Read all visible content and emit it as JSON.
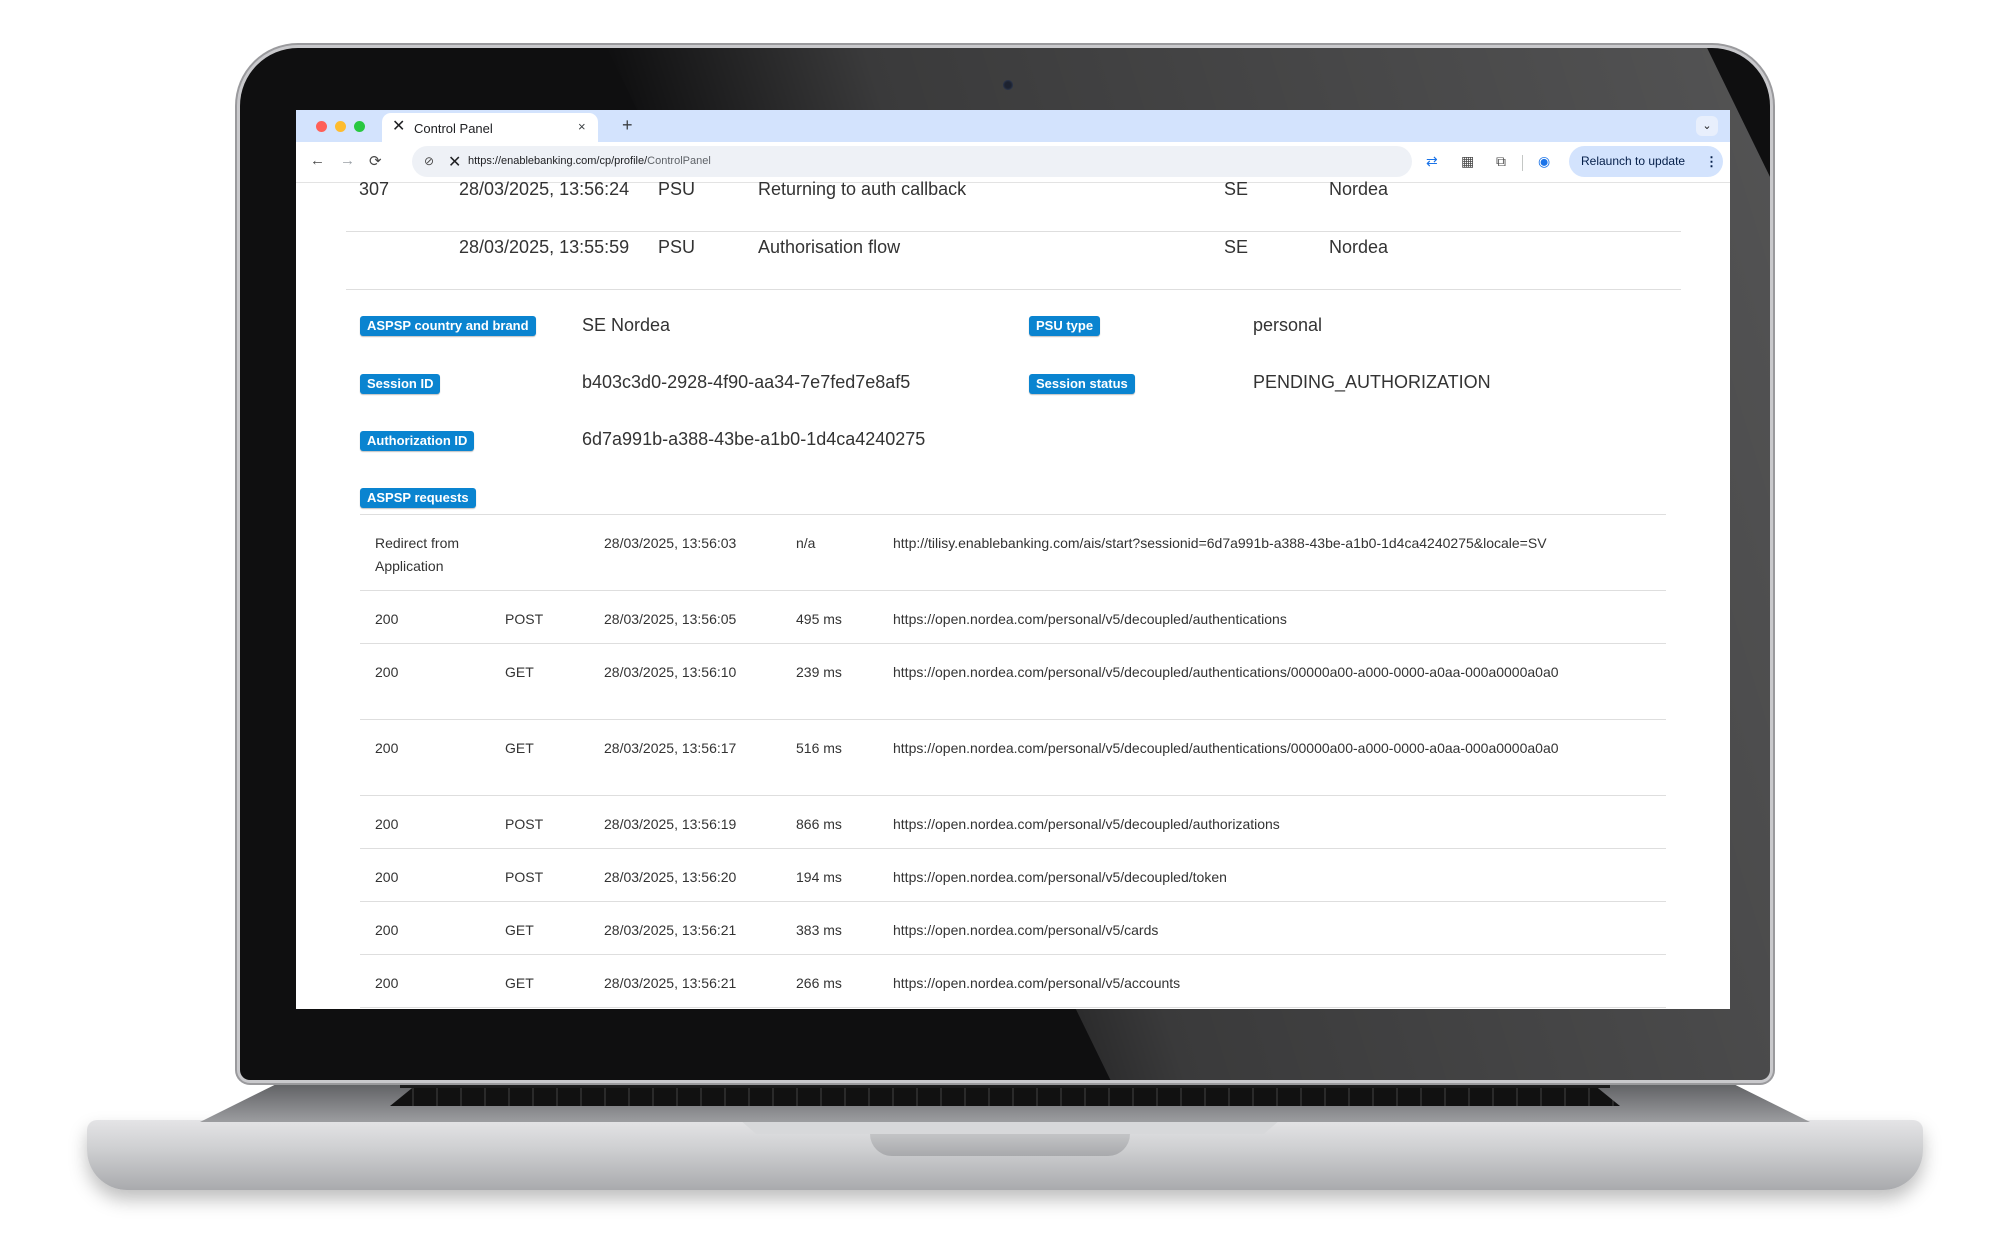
{
  "browser": {
    "tab": {
      "title": "Control Panel",
      "favicon": "x-logo-icon",
      "close": "×"
    },
    "new_tab": "+",
    "tab_dropdown": "⌄",
    "nav": {
      "back": "←",
      "forward": "→",
      "reload": "⟳"
    },
    "url": {
      "host": "https://enablebanking.com/cp/profile/",
      "path": "ControlPanel"
    },
    "relaunch_label": "Relaunch to update",
    "kebab": "⋮"
  },
  "log": [
    {
      "code": "307",
      "time": "28/03/2025, 13:56:24",
      "actor": "PSU",
      "event": "Returning to auth callback",
      "country": "SE",
      "brand": "Nordea"
    },
    {
      "code": "",
      "time": "28/03/2025, 13:55:59",
      "actor": "PSU",
      "event": "Authorisation flow",
      "country": "SE",
      "brand": "Nordea"
    }
  ],
  "details": {
    "aspsp_label": "ASPSP country and brand",
    "aspsp_value": "SE Nordea",
    "psu_type_label": "PSU type",
    "psu_type_value": "personal",
    "session_id_label": "Session ID",
    "session_id_value": "b403c3d0-2928-4f90-aa34-7e7fed7e8af5",
    "session_status_label": "Session status",
    "session_status_value": "PENDING_AUTHORIZATION",
    "authorization_id_label": "Authorization ID",
    "authorization_id_value": "6d7a991b-a388-43be-a1b0-1d4ca4240275",
    "requests_label": "ASPSP requests"
  },
  "requests": [
    {
      "status": "Redirect from Application",
      "method": "",
      "time": "28/03/2025, 13:56:03",
      "duration": "n/a",
      "url": "http://tilisy.enablebanking.com/ais/start?sessionid=6d7a991b-a388-43be-a1b0-1d4ca4240275&locale=SV"
    },
    {
      "status": "200",
      "method": "POST",
      "time": "28/03/2025, 13:56:05",
      "duration": "495 ms",
      "url": "https://open.nordea.com/personal/v5/decoupled/authentications"
    },
    {
      "status": "200",
      "method": "GET",
      "time": "28/03/2025, 13:56:10",
      "duration": "239 ms",
      "url": "https://open.nordea.com/personal/v5/decoupled/authentications/00000a00-a000-0000-a0aa-000a0000a0a0"
    },
    {
      "status": "200",
      "method": "GET",
      "time": "28/03/2025, 13:56:17",
      "duration": "516 ms",
      "url": "https://open.nordea.com/personal/v5/decoupled/authentications/00000a00-a000-0000-a0aa-000a0000a0a0"
    },
    {
      "status": "200",
      "method": "POST",
      "time": "28/03/2025, 13:56:19",
      "duration": "866 ms",
      "url": "https://open.nordea.com/personal/v5/decoupled/authorizations"
    },
    {
      "status": "200",
      "method": "POST",
      "time": "28/03/2025, 13:56:20",
      "duration": "194 ms",
      "url": "https://open.nordea.com/personal/v5/decoupled/token"
    },
    {
      "status": "200",
      "method": "GET",
      "time": "28/03/2025, 13:56:21",
      "duration": "383 ms",
      "url": "https://open.nordea.com/personal/v5/cards"
    },
    {
      "status": "200",
      "method": "GET",
      "time": "28/03/2025, 13:56:21",
      "duration": "266 ms",
      "url": "https://open.nordea.com/personal/v5/accounts"
    }
  ],
  "colors": {
    "badge": "#0a84d0",
    "tabbar": "#d3e3fd",
    "relaunch": "#d3e3fd"
  }
}
